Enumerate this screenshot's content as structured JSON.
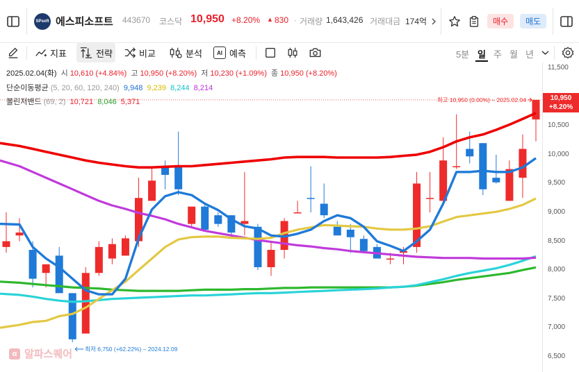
{
  "header": {
    "logo_text": "SPsoft",
    "stock_name": "에스피소프트",
    "stock_code": "443670",
    "market": "코스닥",
    "price": "10,950",
    "change_pct": "+8.20%",
    "change_abs": "830",
    "volume_label": "거래량",
    "volume": "1,643,426",
    "value_label": "거래대금",
    "value": "174억",
    "buy_label": "매수",
    "sell_label": "매도"
  },
  "toolbar": {
    "indicator_label": "지표",
    "strategy_label": "전략",
    "compare_label": "비교",
    "analysis_label": "분석",
    "ai_badge": "AI",
    "forecast_label": "예측",
    "periods": [
      "5분",
      "일",
      "주",
      "월",
      "년"
    ],
    "active_period": "일"
  },
  "legend": {
    "ohlc": {
      "date": "2025.02.04(화)",
      "open_label": "시",
      "open": "10,610 (+4.84%)",
      "high_label": "고",
      "high": "10,950 (+8.20%)",
      "low_label": "저",
      "low": "10,230 (+1.09%)",
      "close_label": "종",
      "close": "10,950 (+8.20%)"
    },
    "ma": {
      "title": "단순이동평균",
      "params": "(5, 20, 60, 120, 240)",
      "v1": "9,948",
      "v2": "9,239",
      "v3": "8,244",
      "v4": "8,214"
    },
    "bb": {
      "title": "볼린저밴드",
      "params": "(69, 2)",
      "v1": "10,721",
      "v2": "8,046",
      "v3": "5,371"
    }
  },
  "annotations": {
    "high_note": "최고 10,950 (0.00%) – 2025.02.04",
    "low_note": "최저 6,750 (+62.22%) – 2024.12.09"
  },
  "price_tag": {
    "price": "10,950",
    "pct": "+8.20%"
  },
  "watermark": "알파스퀘어",
  "colors": {
    "up": "#ee2b2b",
    "down": "#1f7ad8",
    "ma5": "#1f7ad8",
    "ma20": "#e3c843",
    "ma60": "#2ad3d8",
    "ma120": "#c03adb",
    "bb_upper": "#ee0000",
    "bb_mid": "#2db82d"
  },
  "chart_data": {
    "type": "candlestick",
    "y_ticks": [
      "11,500",
      "11,000",
      "10,500",
      "10,000",
      "9,500",
      "9,000",
      "8,500",
      "8,000",
      "7,500",
      "7,000",
      "6,500"
    ],
    "ylim": [
      6450,
      11550
    ],
    "candles": [
      {
        "o": 8400,
        "h": 9000,
        "l": 8300,
        "c": 8500
      },
      {
        "o": 8600,
        "h": 8900,
        "l": 8500,
        "c": 8650
      },
      {
        "o": 8350,
        "h": 8500,
        "l": 7700,
        "c": 7850
      },
      {
        "o": 7950,
        "h": 8100,
        "l": 7700,
        "c": 8100
      },
      {
        "o": 8250,
        "h": 8400,
        "l": 7700,
        "c": 7600
      },
      {
        "o": 7600,
        "h": 7600,
        "l": 6750,
        "c": 6800
      },
      {
        "o": 6900,
        "h": 8050,
        "l": 6900,
        "c": 7950
      },
      {
        "o": 7950,
        "h": 8500,
        "l": 7900,
        "c": 8400
      },
      {
        "o": 8200,
        "h": 8550,
        "l": 8100,
        "c": 8450
      },
      {
        "o": 8250,
        "h": 8600,
        "l": 8250,
        "c": 8550
      },
      {
        "o": 8500,
        "h": 9600,
        "l": 8400,
        "c": 9250
      },
      {
        "o": 9200,
        "h": 9800,
        "l": 9200,
        "c": 9550
      },
      {
        "o": 9800,
        "h": 9900,
        "l": 9400,
        "c": 9650
      },
      {
        "o": 9800,
        "h": 10400,
        "l": 9300,
        "c": 9400
      },
      {
        "o": 8800,
        "h": 8900,
        "l": 8750,
        "c": 9100
      },
      {
        "o": 9100,
        "h": 9150,
        "l": 8750,
        "c": 8700
      },
      {
        "o": 8950,
        "h": 9000,
        "l": 8750,
        "c": 8800
      },
      {
        "o": 8950,
        "h": 8950,
        "l": 8600,
        "c": 8650
      },
      {
        "o": 8800,
        "h": 9700,
        "l": 8600,
        "c": 8850
      },
      {
        "o": 8750,
        "h": 8800,
        "l": 8000,
        "c": 8050
      },
      {
        "o": 8050,
        "h": 8500,
        "l": 7900,
        "c": 8350
      },
      {
        "o": 8350,
        "h": 8900,
        "l": 8200,
        "c": 8850
      },
      {
        "o": 9000,
        "h": 9200,
        "l": 9000,
        "c": 9000
      },
      {
        "o": 9250,
        "h": 9800,
        "l": 9000,
        "c": 9240
      },
      {
        "o": 9150,
        "h": 9500,
        "l": 8900,
        "c": 8950
      },
      {
        "o": 8750,
        "h": 8850,
        "l": 8600,
        "c": 8600
      },
      {
        "o": 8700,
        "h": 8800,
        "l": 8300,
        "c": 8570
      },
      {
        "o": 8540,
        "h": 8600,
        "l": 8300,
        "c": 8330
      },
      {
        "o": 8400,
        "h": 8450,
        "l": 8200,
        "c": 8200
      },
      {
        "o": 8200,
        "h": 8300,
        "l": 8100,
        "c": 8200
      },
      {
        "o": 8300,
        "h": 8400,
        "l": 8100,
        "c": 8330
      },
      {
        "o": 8400,
        "h": 9700,
        "l": 8300,
        "c": 9500
      },
      {
        "o": 9250,
        "h": 9700,
        "l": 9000,
        "c": 9250
      },
      {
        "o": 9200,
        "h": 10300,
        "l": 9150,
        "c": 9900
      },
      {
        "o": 9800,
        "h": 10700,
        "l": 9750,
        "c": 9800
      },
      {
        "o": 10100,
        "h": 10400,
        "l": 9850,
        "c": 9970
      },
      {
        "o": 10200,
        "h": 10200,
        "l": 9300,
        "c": 9400
      },
      {
        "o": 9600,
        "h": 10000,
        "l": 9500,
        "c": 9520
      },
      {
        "o": 9200,
        "h": 9900,
        "l": 9200,
        "c": 9750
      },
      {
        "o": 9600,
        "h": 10350,
        "l": 9250,
        "c": 10100
      },
      {
        "o": 10610,
        "h": 10950,
        "l": 10230,
        "c": 10950
      }
    ],
    "ma5": [
      8800,
      8790,
      8400,
      8200,
      8050,
      7850,
      7650,
      7580,
      7580,
      7850,
      8550,
      9050,
      9280,
      9350,
      9300,
      9150,
      9040,
      8880,
      8760,
      8720,
      8600,
      8580,
      8630,
      8700,
      8850,
      8950,
      8900,
      8750,
      8500,
      8420,
      8330,
      8500,
      8700,
      9150,
      9700,
      9700,
      9720,
      9700,
      9700,
      9780,
      9940
    ],
    "ma20": [
      7000,
      7050,
      7100,
      7120,
      7200,
      7240,
      7350,
      7500,
      7650,
      7800,
      8000,
      8200,
      8400,
      8530,
      8570,
      8580,
      8580,
      8560,
      8550,
      8540,
      8560,
      8640,
      8700,
      8740,
      8780,
      8770,
      8760,
      8750,
      8720,
      8700,
      8700,
      8720,
      8760,
      8840,
      8920,
      8950,
      8980,
      9010,
      9060,
      9130,
      9240
    ],
    "ma60": [
      7590,
      7570,
      7540,
      7500,
      7470,
      7450,
      7460,
      7480,
      7500,
      7510,
      7520,
      7530,
      7540,
      7550,
      7560,
      7560,
      7570,
      7580,
      7590,
      7600,
      7600,
      7610,
      7620,
      7630,
      7640,
      7650,
      7660,
      7670,
      7680,
      7700,
      7710,
      7740,
      7790,
      7840,
      7900,
      7950,
      7990,
      8030,
      8090,
      8160,
      8240
    ],
    "ma120": [
      9900,
      9800,
      9700,
      9600,
      9500,
      9400,
      9300,
      9200,
      9120,
      9060,
      8990,
      8940,
      8880,
      8800,
      8740,
      8680,
      8640,
      8600,
      8560,
      8520,
      8490,
      8460,
      8430,
      8410,
      8380,
      8360,
      8330,
      8310,
      8290,
      8270,
      8250,
      8230,
      8220,
      8210,
      8210,
      8210,
      8200,
      8200,
      8200,
      8200,
      8214
    ],
    "bb_upper": [
      10200,
      10150,
      10100,
      10050,
      10000,
      9950,
      9900,
      9860,
      9830,
      9800,
      9780,
      9780,
      9790,
      9800,
      9800,
      9820,
      9840,
      9860,
      9880,
      9900,
      9920,
      9950,
      9960,
      9960,
      9960,
      9950,
      9950,
      9950,
      9950,
      9960,
      9980,
      10000,
      10050,
      10130,
      10230,
      10300,
      10350,
      10430,
      10520,
      10620,
      10721
    ],
    "bb_mid": [
      7800,
      7780,
      7760,
      7740,
      7720,
      7700,
      7690,
      7680,
      7660,
      7650,
      7640,
      7640,
      7640,
      7640,
      7650,
      7660,
      7660,
      7660,
      7670,
      7670,
      7680,
      7690,
      7690,
      7700,
      7700,
      7700,
      7700,
      7700,
      7700,
      7700,
      7710,
      7730,
      7760,
      7790,
      7830,
      7860,
      7890,
      7920,
      7950,
      8000,
      8046
    ]
  }
}
